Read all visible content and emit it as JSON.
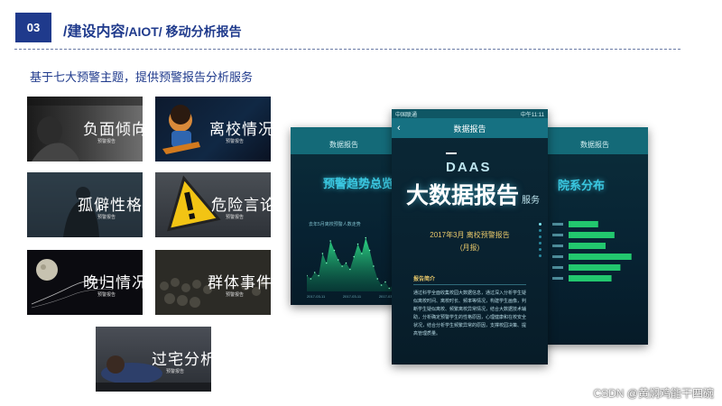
{
  "header": {
    "section_number": "03",
    "title_main": "/建设内容",
    "title_rest": "/AIOT/ 移动分析报告"
  },
  "subtitle": "基于七大预警主题，提供预警报告分析服务",
  "tiles": [
    {
      "label": "负面倾向",
      "sub": "预警报告"
    },
    {
      "label": "离校情况",
      "sub": "预警报告"
    },
    {
      "label": "孤僻性格",
      "sub": "预警报告"
    },
    {
      "label": "危险言论",
      "sub": "预警报告"
    },
    {
      "label": "晚归情况",
      "sub": "预警报告"
    },
    {
      "label": "群体事件",
      "sub": "预警报告"
    },
    {
      "label": "过宅分析",
      "sub": "预警报告"
    }
  ],
  "phone_left": {
    "header": "数据报告",
    "heading": "预警趋势总览",
    "chart_title": "去年5月离校预警人数走势",
    "dates": [
      "2017-03-11",
      "2017-03-11",
      "2017-03-11"
    ],
    "chart_data": {
      "type": "area",
      "values": [
        5,
        4,
        6,
        5,
        12,
        9,
        16,
        13,
        10,
        8,
        9,
        7,
        11,
        15,
        12,
        17,
        13,
        8,
        4,
        2,
        3,
        1,
        2,
        1
      ],
      "ylim": [
        0,
        20
      ]
    }
  },
  "phone_center": {
    "status_left": "中国联通",
    "status_right": "中午11:11",
    "header": "数据报告",
    "logo": "DAAS",
    "big_title_1": "大数据",
    "big_title_2": "报告",
    "big_title_tag": "服务",
    "report_date": "2017年3月 离校预警报告",
    "report_period": "(月报)",
    "section_title": "报告简介",
    "body": "通过科学全面收集校园大数据信息，通过深入分析学生疑似离校时间、离校时长、频率等情况，构建学生画像，判断学生疑似离校、频繁离校异常情况，结合大数据技术辅助，分析确定预警学生的性格原因，心理健康和在校安全状况，结合分析学生频繁异常的原因，支撑校园决策、提高管理质量。"
  },
  "phone_right": {
    "header": "数据报告",
    "heading": "院系分布",
    "chart_data": {
      "type": "bar",
      "orientation": "horizontal",
      "categories": [
        "",
        "",
        "",
        "",
        "",
        ""
      ],
      "values": [
        40,
        62,
        50,
        85,
        70,
        58
      ],
      "xlim": [
        0,
        100
      ]
    }
  },
  "watermark": "CSDN @黄焖鸡能干四碗"
}
